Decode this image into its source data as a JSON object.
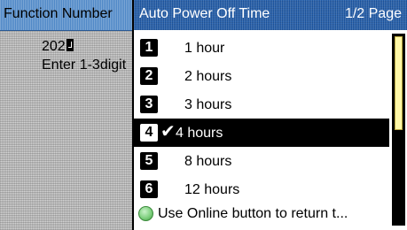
{
  "background_panel": {
    "title": "Function Number",
    "value": "202",
    "hint": "Enter 1-3digit"
  },
  "dialog": {
    "title": "Auto Power Off Time",
    "page": "1/2 Page",
    "items": [
      {
        "number": "1",
        "label": "1 hour"
      },
      {
        "number": "2",
        "label": "2 hours"
      },
      {
        "number": "3",
        "label": "3 hours"
      },
      {
        "number": "4",
        "label": "4 hours",
        "selected": true
      },
      {
        "number": "5",
        "label": "8 hours"
      },
      {
        "number": "6",
        "label": "12 hours"
      }
    ],
    "footer_hint": "Use Online button to return t...",
    "check_mark": "✔",
    "scroll_position_fraction": 0.5
  },
  "colors": {
    "header_blue": "#1f5aa8",
    "selected_background": "#000000",
    "scroll_thumb": "#fff8a8",
    "online_button": "#7fd07f"
  },
  "icons": {
    "cursor": "enter-cursor-icon",
    "online_button": "online-button-icon",
    "check": "check-mark-icon"
  }
}
